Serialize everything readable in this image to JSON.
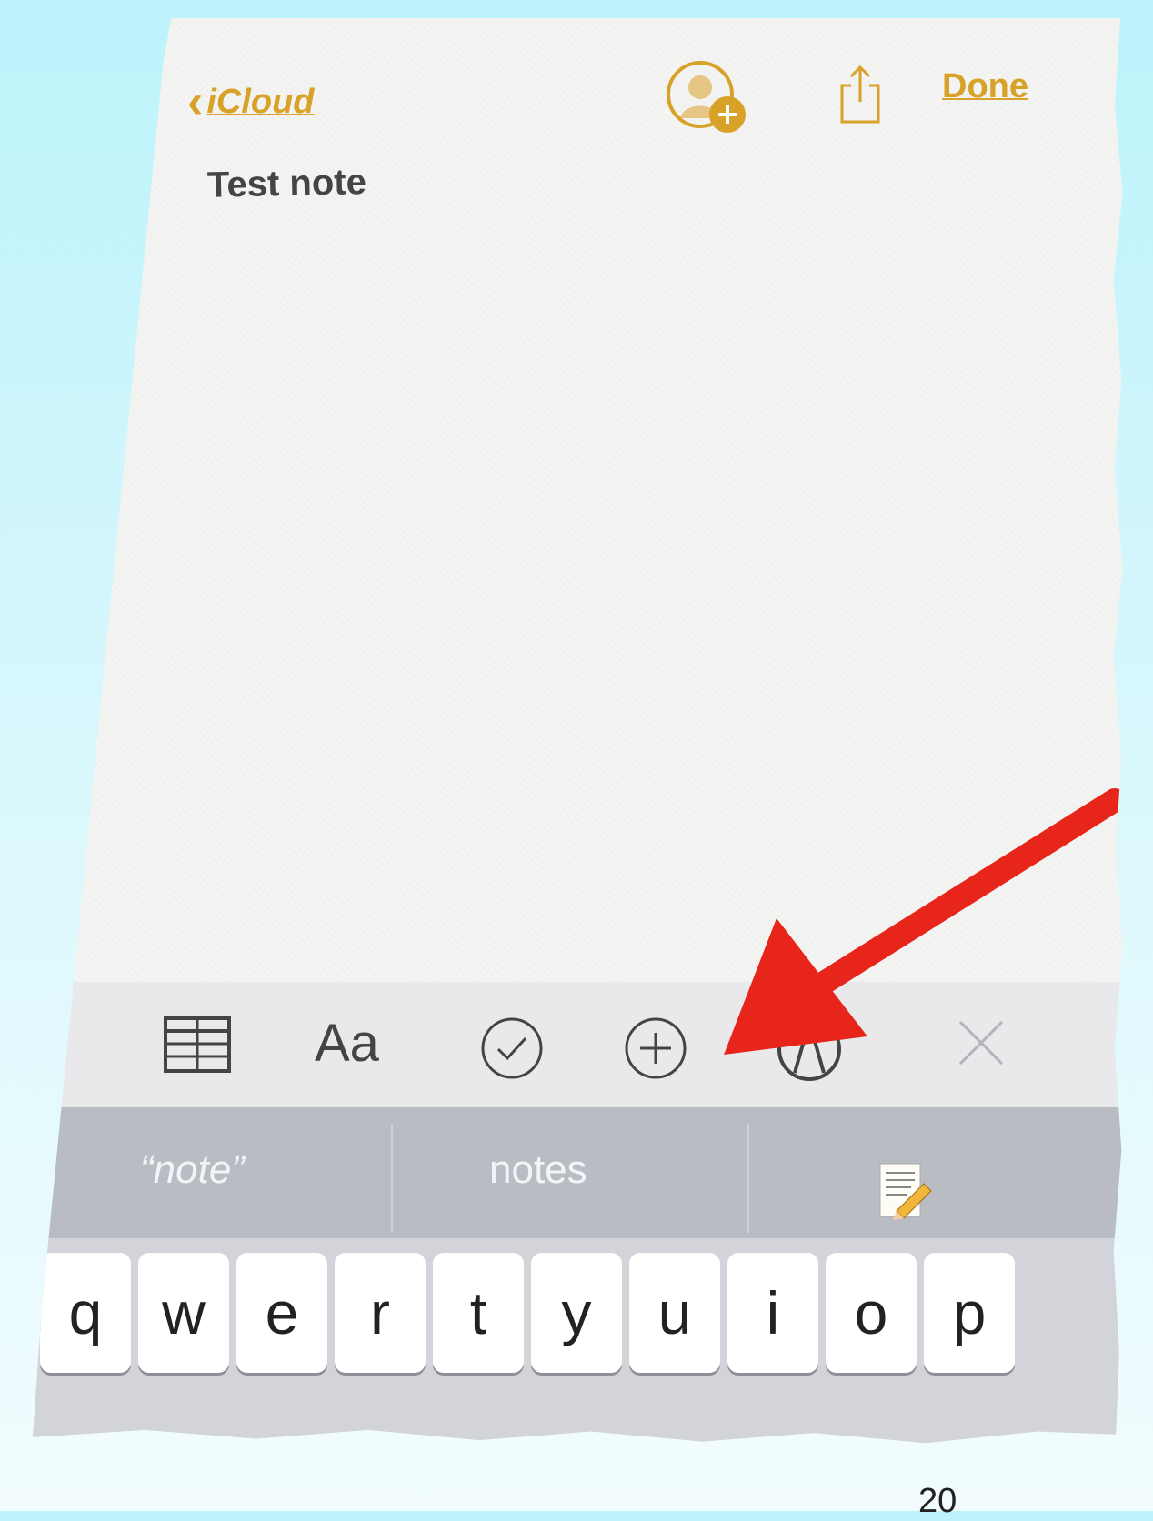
{
  "nav": {
    "back_label": "iCloud",
    "done_label": "Done"
  },
  "note": {
    "title": "Test note"
  },
  "toolbar": {
    "format_label": "Aa",
    "items": [
      "table-icon",
      "format-text",
      "checklist-icon",
      "plus-icon",
      "markup-icon",
      "close-icon"
    ]
  },
  "suggestions": {
    "items": [
      "“note”",
      "notes"
    ]
  },
  "keyboard": {
    "keys": [
      "q",
      "w",
      "e",
      "r",
      "t",
      "y",
      "u",
      "i",
      "o",
      "p"
    ]
  },
  "page_number": "20",
  "colors": {
    "accent": "#d8a128",
    "arrow": "#e8251a"
  }
}
